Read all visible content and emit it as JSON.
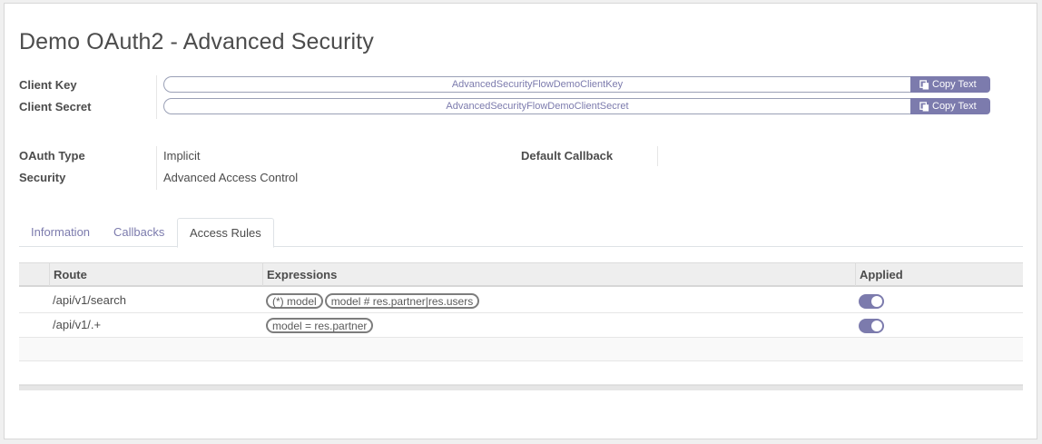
{
  "form": {
    "title": "Demo OAuth2 - Advanced Security",
    "client_key_label": "Client Key",
    "client_key_value": "AdvancedSecurityFlowDemoClientKey",
    "client_secret_label": "Client Secret",
    "client_secret_value": "AdvancedSecurityFlowDemoClientSecret",
    "copy_label": "Copy Text",
    "oauth_type_label": "OAuth Type",
    "oauth_type_value": "Implicit",
    "security_label": "Security",
    "security_value": "Advanced Access Control",
    "default_callback_label": "Default Callback",
    "default_callback_value": ""
  },
  "tabs": [
    {
      "label": "Information",
      "active": false
    },
    {
      "label": "Callbacks",
      "active": false
    },
    {
      "label": "Access Rules",
      "active": true
    }
  ],
  "table": {
    "columns": [
      "Route",
      "Expressions",
      "Applied"
    ],
    "rows": [
      {
        "route": "/api/v1/search",
        "expressions": [
          "(*) model",
          "model # res.partner|res.users"
        ],
        "applied": true
      },
      {
        "route": "/api/v1/.+",
        "expressions": [
          "model = res.partner"
        ],
        "applied": true
      }
    ]
  },
  "colors": {
    "accent": "#7c7bad",
    "text": "#4c4c4c",
    "header_bg": "#eeeeee"
  },
  "icons": {
    "copy": "copy-icon"
  }
}
